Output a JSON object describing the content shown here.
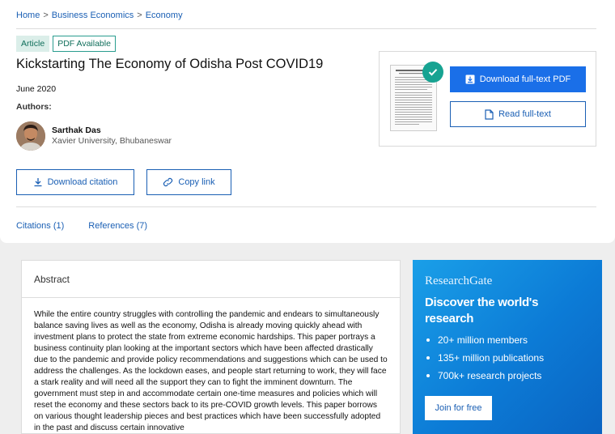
{
  "breadcrumb": [
    "Home",
    "Business Economics",
    "Economy"
  ],
  "badges": {
    "type": "Article",
    "availability": "PDF Available"
  },
  "paper": {
    "title": "Kickstarting The Economy of Odisha Post COVID19",
    "date": "June 2020",
    "authors_label": "Authors:",
    "author": {
      "name": "Sarthak Das",
      "affiliation": "Xavier University, Bhubaneswar"
    }
  },
  "actions": {
    "download_citation": "Download citation",
    "copy_link": "Copy link"
  },
  "tabs": {
    "citations": "Citations (1)",
    "references": "References (7)"
  },
  "preview": {
    "download_pdf": "Download full-text PDF",
    "read_fulltext": "Read full-text"
  },
  "abstract": {
    "heading": "Abstract",
    "text": "While the entire country struggles with controlling the pandemic and endears to simultaneously balance saving lives as well as the economy, Odisha is already moving quickly ahead with investment plans to protect the state from extreme economic hardships. This paper portrays a business continuity plan looking at the important sectors which have been affected drastically due to the pandemic and provide policy recommendations and suggestions which can be used to address the challenges. As the lockdown eases, and people start returning to work, they will face a stark reality and will need all the support they can to fight the imminent downturn. The government must step in and accommodate certain one-time measures and policies which will reset the economy and these sectors back to its pre-COVID growth levels. This paper borrows on various thought leadership pieces and best practices which have been successfully adopted in the past and discuss certain innovative"
  },
  "promo": {
    "brand": "ResearchGate",
    "headline": "Discover the world's research",
    "stats": [
      "20+ million members",
      "135+ million publications",
      "700k+ research projects"
    ],
    "cta": "Join for free"
  },
  "colors": {
    "link": "#1a5fb4",
    "primary": "#1a6fe8",
    "teal": "#17a392",
    "promo_bg": "#0c7bd6"
  }
}
